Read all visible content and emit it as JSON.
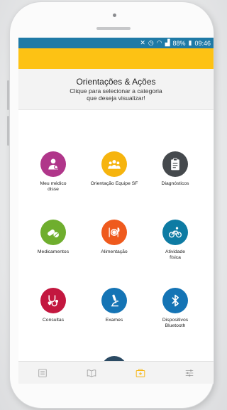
{
  "status_bar": {
    "battery": "88%",
    "time": "09:46"
  },
  "header": {
    "title": "Orientações & Ações",
    "subtitle_line1": "Clique para selecionar a categoria",
    "subtitle_line2": "que deseja visualizar!"
  },
  "tiles": [
    {
      "label": "Meu médico",
      "label2": "disse",
      "icon": "doctor-icon",
      "color": "#b0368a"
    },
    {
      "label": "Orientação Equipe SF",
      "label2": "",
      "icon": "team-icon",
      "color": "#f6b40e"
    },
    {
      "label": "Diagnósticos",
      "label2": "",
      "icon": "clipboard-icon",
      "color": "#45494d"
    },
    {
      "label": "Medicamentos",
      "label2": "",
      "icon": "pills-icon",
      "color": "#6fae2e"
    },
    {
      "label": "Alimentação",
      "label2": "",
      "icon": "cutlery-icon",
      "color": "#ef5a1d"
    },
    {
      "label": "Atividade",
      "label2": "física",
      "icon": "bike-icon",
      "color": "#0e7ba3"
    },
    {
      "label": "Consultas",
      "label2": "",
      "icon": "stethoscope-icon",
      "color": "#c3173f"
    },
    {
      "label": "Exames",
      "label2": "",
      "icon": "microscope-icon",
      "color": "#1474b5"
    },
    {
      "label": "Dispositivos",
      "label2": "Bluetooth",
      "icon": "bluetooth-icon",
      "color": "#1474b5"
    },
    {
      "label": "",
      "label2": "",
      "icon": "meeting-icon",
      "color": "#2b4a63"
    }
  ],
  "tabbar": {
    "tabs": [
      {
        "icon": "list-icon",
        "active": false
      },
      {
        "icon": "book-icon",
        "active": false
      },
      {
        "icon": "medical-kit-icon",
        "active": true
      },
      {
        "icon": "sliders-icon",
        "active": false
      }
    ],
    "active_color": "#f6b40e",
    "inactive_color": "#9a9a9a"
  }
}
